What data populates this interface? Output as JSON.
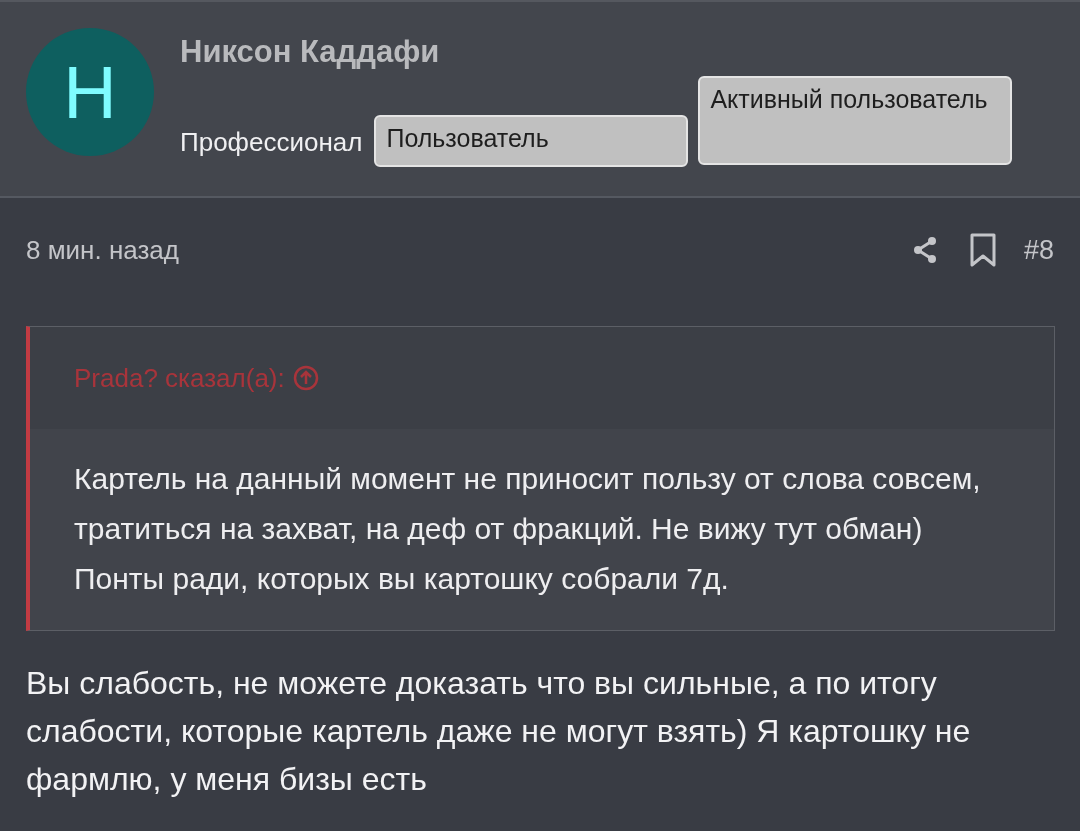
{
  "author": {
    "initial": "Н",
    "name": "Никсон Каддафи",
    "title": "Профессионал",
    "badges": [
      "Пользователь",
      "Активный пользователь"
    ]
  },
  "post": {
    "time": "8 мин. назад",
    "number": "#8"
  },
  "quote": {
    "attribution": "Prada? сказал(а):",
    "text": "Картель на данный момент не приносит пользу от слова совсем, тратиться на захват, на деф от фракций. Не вижу тут обман) Понты ради, которых вы картошку собрали 7д."
  },
  "message": "Вы слабость, не можете доказать что вы сильные, а по итогу слабости, которые картель даже не могут взять) Я картошку не фармлю, у меня бизы есть"
}
